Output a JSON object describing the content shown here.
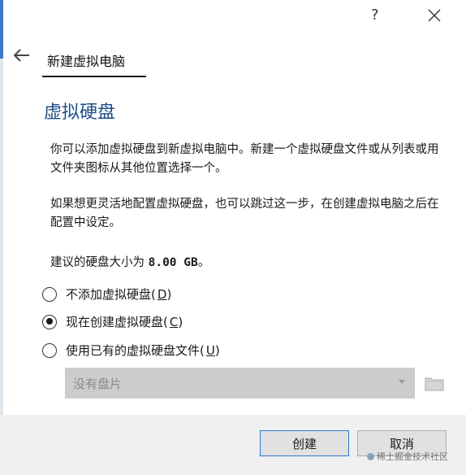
{
  "titlebar": {
    "help": "?"
  },
  "wizard": {
    "title": "新建虚拟电脑"
  },
  "section": {
    "heading": "虚拟硬盘"
  },
  "description": {
    "p1": "你可以添加虚拟硬盘到新虚拟电脑中。新建一个虚拟硬盘文件或从列表或用文件夹图标从其他位置选择一个。",
    "p2": "如果想更灵活地配置虚拟硬盘，也可以跳过这一步，在创建虚拟电脑之后在配置中设定。",
    "size_prefix": "建议的硬盘大小为",
    "size_value": "8.00 GB",
    "size_suffix": "。"
  },
  "options": [
    {
      "label": "不添加虚拟硬盘",
      "mnemonic": "D",
      "checked": false
    },
    {
      "label": "现在创建虚拟硬盘",
      "mnemonic": "C",
      "checked": true
    },
    {
      "label": "使用已有的虚拟硬盘文件",
      "mnemonic": "U",
      "checked": false
    }
  ],
  "disk_select": {
    "value": "没有盘片"
  },
  "buttons": {
    "create": "创建",
    "cancel": "取消"
  },
  "watermark": {
    "text": "稀土掘金技术社区"
  }
}
